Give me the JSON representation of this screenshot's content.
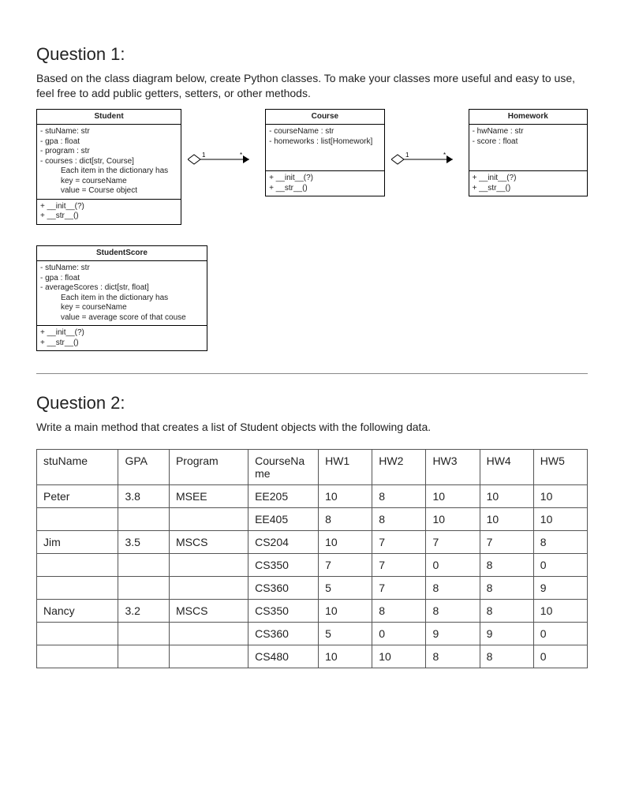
{
  "q1": {
    "heading": "Question 1:",
    "text": "Based on the class diagram below, create Python classes. To make your classes more useful and easy to use, feel free to add public getters, setters, or other methods.",
    "classes": {
      "student": {
        "name": "Student",
        "attrs": [
          "- stuName: str",
          "- gpa : float",
          "- program : str",
          "- courses : dict[str, Course]"
        ],
        "attr_notes": [
          "Each item in the dictionary has",
          "key = courseName",
          "value = Course object"
        ],
        "ops": [
          "+ __init__(?)",
          "+ __str__()"
        ]
      },
      "course": {
        "name": "Course",
        "attrs": [
          "- courseName : str",
          "- homeworks : list[Homework]"
        ],
        "ops": [
          "+ __init__(?)",
          "+ __str__()"
        ]
      },
      "homework": {
        "name": "Homework",
        "attrs": [
          "- hwName : str",
          "- score : float"
        ],
        "ops": [
          "+ __init__(?)",
          "+ __str__()"
        ]
      },
      "studentScore": {
        "name": "StudentScore",
        "attrs": [
          "- stuName: str",
          "- gpa : float",
          "- averageScores : dict[str, float]"
        ],
        "attr_notes": [
          "Each item in the dictionary has",
          "key = courseName",
          "value = average score of that couse"
        ],
        "ops": [
          "+ __init__(?)",
          "+ __str__()"
        ]
      }
    },
    "multiplicity": {
      "one": "1",
      "many": "*"
    }
  },
  "q2": {
    "heading": "Question 2:",
    "text": "Write a main method that creates a list of Student objects with the following data.",
    "headers": [
      "stuName",
      "GPA",
      "Program",
      "CourseName",
      "HW1",
      "HW2",
      "HW3",
      "HW4",
      "HW5"
    ],
    "rows": [
      [
        "Peter",
        "3.8",
        "MSEE",
        "EE205",
        "10",
        "8",
        "10",
        "10",
        "10"
      ],
      [
        "",
        "",
        "",
        "EE405",
        "8",
        "8",
        "10",
        "10",
        "10"
      ],
      [
        "Jim",
        "3.5",
        "MSCS",
        "CS204",
        "10",
        "7",
        "7",
        "7",
        "8"
      ],
      [
        "",
        "",
        "",
        "CS350",
        "7",
        "7",
        "0",
        "8",
        "0"
      ],
      [
        "",
        "",
        "",
        "CS360",
        "5",
        "7",
        "8",
        "8",
        "9"
      ],
      [
        "Nancy",
        "3.2",
        "MSCS",
        "CS350",
        "10",
        "8",
        "8",
        "8",
        "10"
      ],
      [
        "",
        "",
        "",
        "CS360",
        "5",
        "0",
        "9",
        "9",
        "0"
      ],
      [
        "",
        "",
        "",
        "CS480",
        "10",
        "10",
        "8",
        "8",
        "0"
      ]
    ]
  }
}
